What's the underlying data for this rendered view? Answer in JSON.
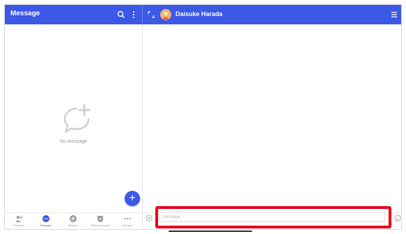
{
  "header": {
    "left_title": "Message",
    "contact_name": "Daisuke Harada",
    "accent_color": "#3b58e6"
  },
  "empty_state": {
    "text": "No message",
    "icon": "add-chat-bubble-icon"
  },
  "fab": {
    "label": "+"
  },
  "tabs": [
    {
      "label": "Contacts",
      "icon": "contacts-icon",
      "active": false
    },
    {
      "label": "Message",
      "icon": "message-icon",
      "active": true
    },
    {
      "label": "Stickers",
      "icon": "stickers-icon",
      "active": false
    },
    {
      "label": "Official Account",
      "icon": "official-account-icon",
      "active": false
    },
    {
      "label": "MyPage",
      "icon": "more-icon",
      "active": false
    }
  ],
  "composer": {
    "placeholder": "Message",
    "highlight_color": "#e8001c"
  }
}
